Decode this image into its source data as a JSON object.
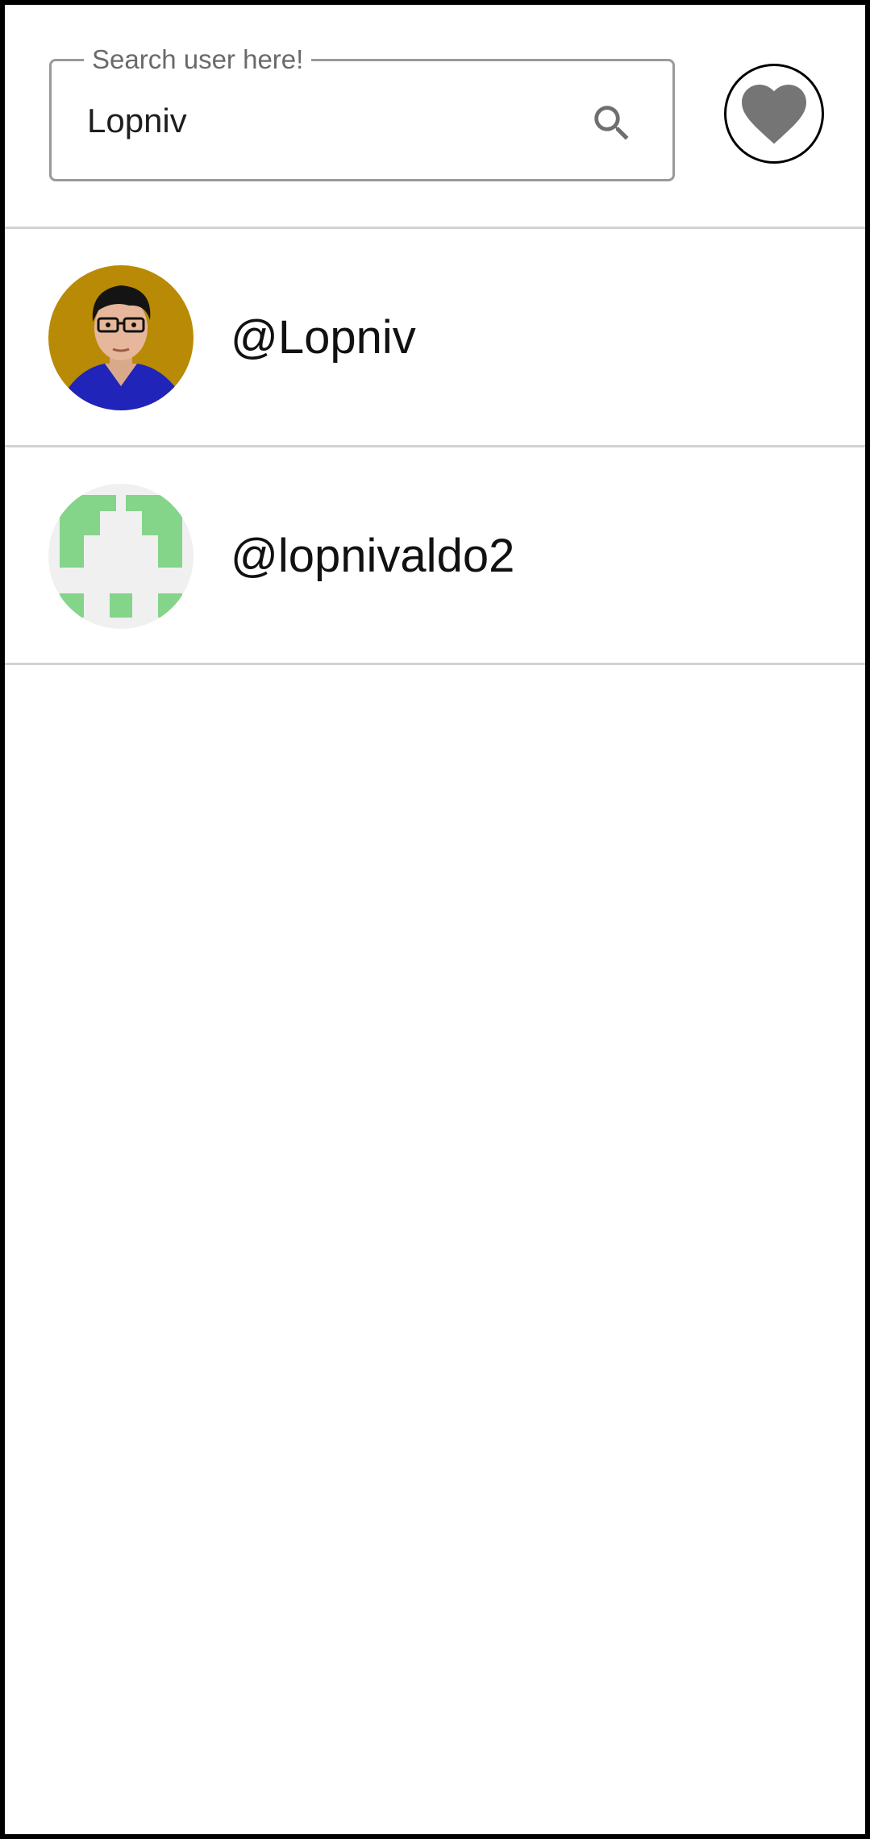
{
  "search": {
    "label": "Search user here!",
    "value": "Lopniv",
    "icon": "search-icon"
  },
  "favorites": {
    "icon": "heart-icon"
  },
  "results": [
    {
      "username": "@Lopniv",
      "avatar": "illustrated-portrait-avatar"
    },
    {
      "username": "@lopnivaldo2",
      "avatar": "green-identicon-avatar"
    }
  ],
  "colors": {
    "heart": "#757575",
    "divider": "#d2d2d2",
    "identicon": "#84d48a",
    "avatar_bg_1": "#b98a05"
  }
}
